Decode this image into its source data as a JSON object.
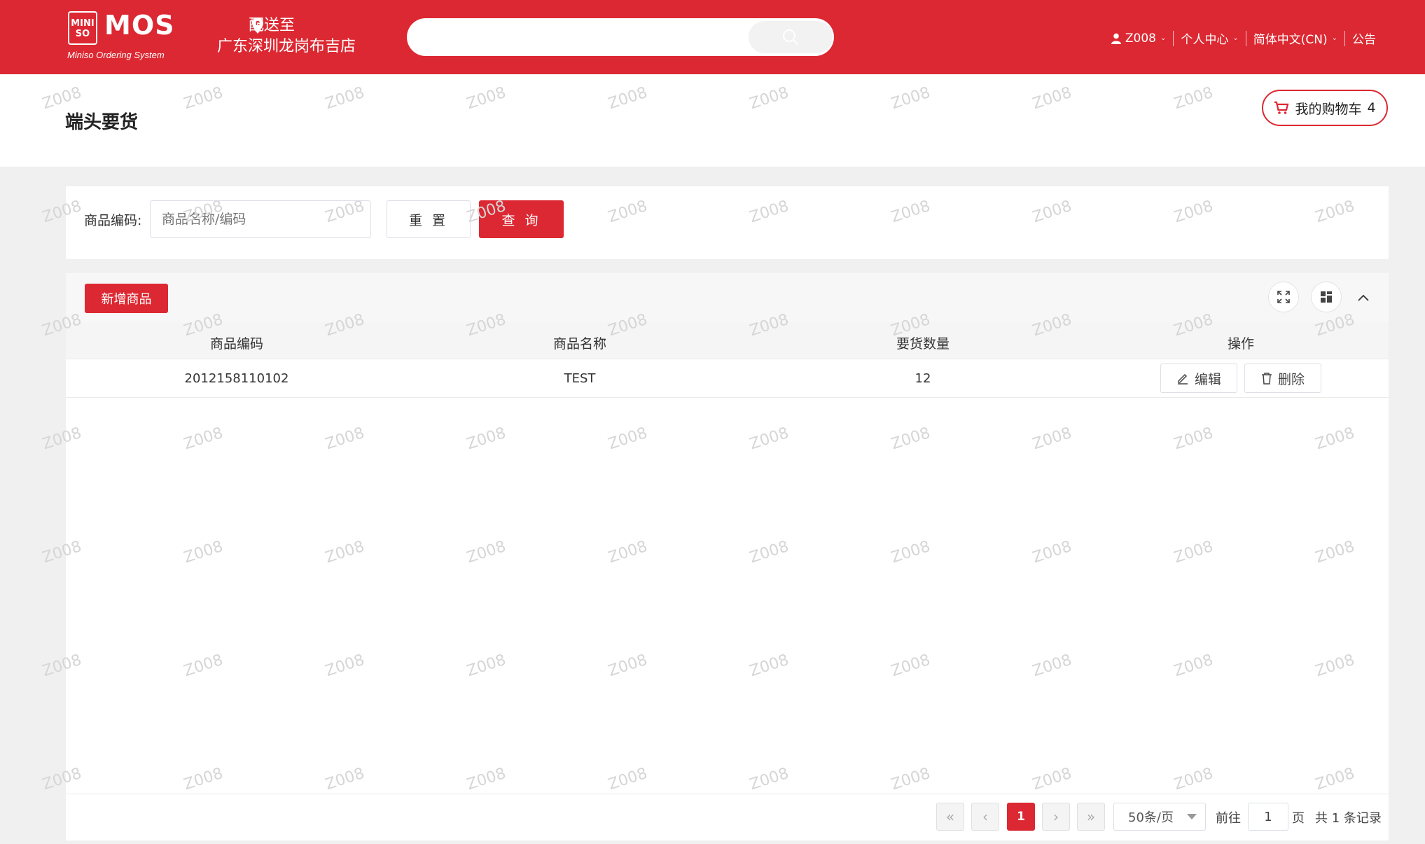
{
  "header": {
    "logo_mark": "MINI SO",
    "logo_text": "MOS",
    "logo_subtitle": "Miniso Ordering System",
    "ship_label": "配送至",
    "ship_store": "广东深圳龙岗布吉店",
    "search_placeholder": "",
    "user": "Z008",
    "personal_center": "个人中心",
    "language": "简体中文(CN)",
    "notice": "公告",
    "brand_color": "#dc2832"
  },
  "page": {
    "title": "端头要货",
    "cart_label": "我的购物车",
    "cart_count": "4"
  },
  "filter": {
    "label": "商品编码:",
    "input_placeholder": "商品名称/编码",
    "input_value": "",
    "reset_label": "重 置",
    "query_label": "查 询"
  },
  "toolbar": {
    "add_label": "新增商品",
    "icons": [
      "fullscreen-icon",
      "layout-icon",
      "chevron-up-icon"
    ]
  },
  "table": {
    "columns": [
      "商品编码",
      "商品名称",
      "要货数量",
      "操作"
    ],
    "rows": [
      {
        "code": "2012158110102",
        "name": "TEST",
        "qty": "12",
        "edit_label": "编辑",
        "delete_label": "删除"
      }
    ]
  },
  "pagination": {
    "current_page": "1",
    "page_size": "50条/页",
    "goto_label": "前往",
    "goto_value": "1",
    "page_unit": "页",
    "total_text": "共 1 条记录"
  },
  "watermark": "Z008"
}
